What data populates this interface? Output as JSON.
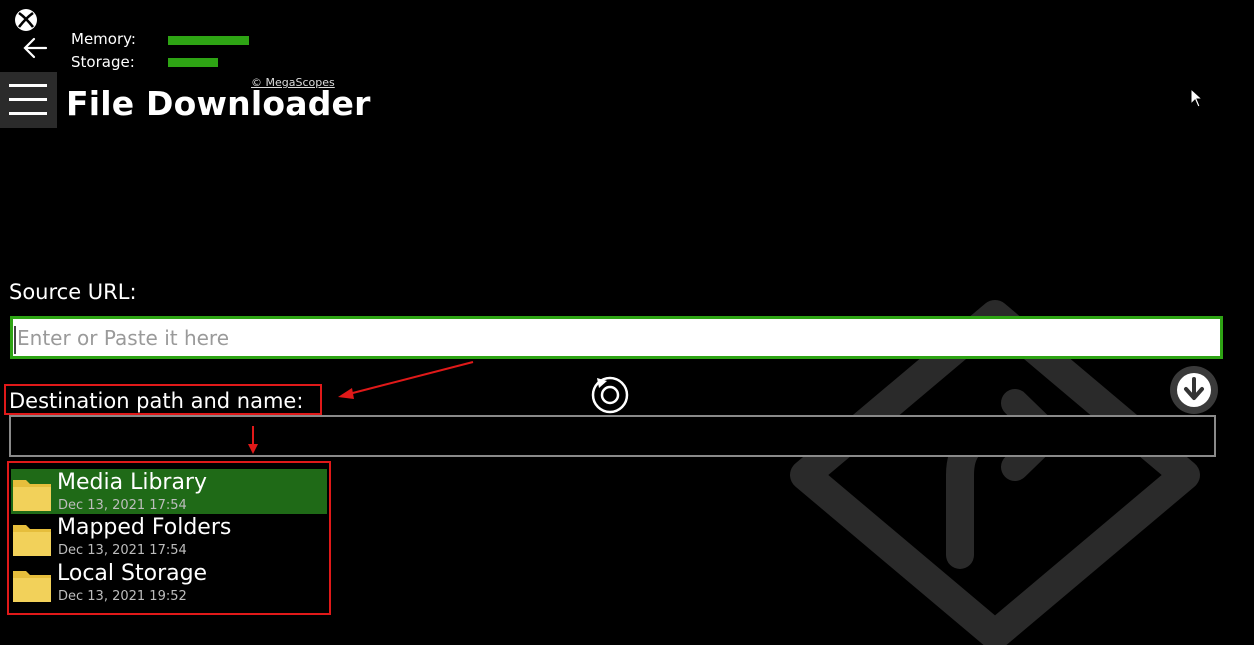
{
  "status": {
    "memory_label": "Memory:",
    "storage_label": "Storage:",
    "memory_level": 0.9,
    "storage_level": 0.55
  },
  "header": {
    "copyright": "© MegaScopes",
    "title": "File Downloader"
  },
  "source": {
    "label": "Source URL:",
    "placeholder": "Enter or Paste it here",
    "value": ""
  },
  "destination": {
    "label": "Destination path and name:",
    "value": ""
  },
  "folders": [
    {
      "name": "Media Library",
      "date": "Dec 13, 2021 17:54",
      "selected": true
    },
    {
      "name": "Mapped Folders",
      "date": "Dec 13, 2021 17:54",
      "selected": false
    },
    {
      "name": "Local Storage",
      "date": "Dec 13, 2021 19:52",
      "selected": false
    }
  ],
  "icons": {
    "xbox": "xbox-logo-icon",
    "back": "back-arrow-icon",
    "menu": "hamburger-menu-icon",
    "refresh": "refresh-icon",
    "download": "download-icon",
    "folder": "folder-icon"
  },
  "colors": {
    "accent": "#2ea414",
    "selected_row": "#1f6a17",
    "annotation": "#e01919",
    "folder": "#f2d15a"
  }
}
